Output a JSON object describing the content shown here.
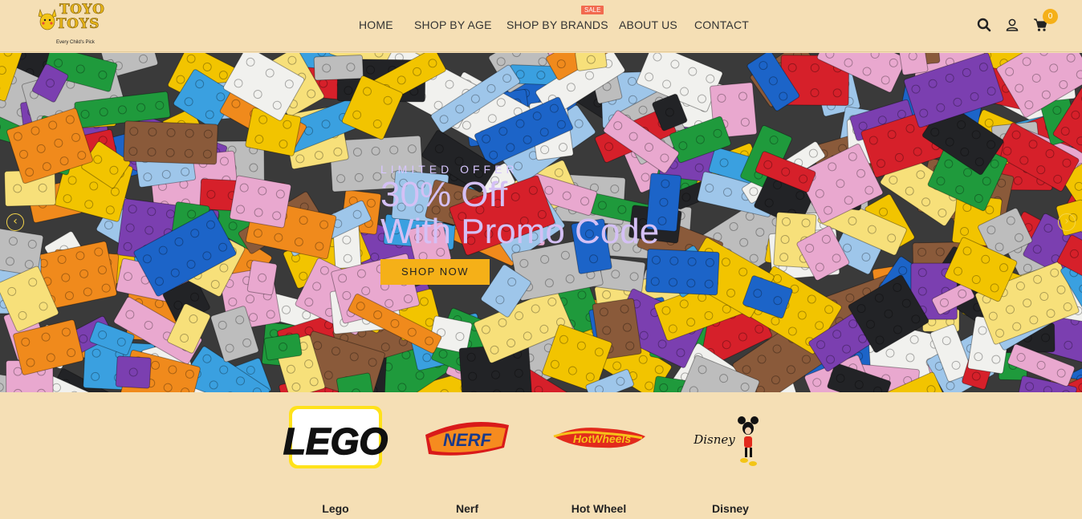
{
  "header": {
    "logo": {
      "line1": "TOYO",
      "line2": "TOYS",
      "tagline": "Every Child's Pick"
    },
    "nav": [
      {
        "label": "HOME"
      },
      {
        "label": "SHOP BY AGE"
      },
      {
        "label": "SHOP BY BRANDS",
        "badge": "SALE"
      },
      {
        "label": "ABOUT US"
      },
      {
        "label": "CONTACT"
      }
    ],
    "icons": [
      "search-icon",
      "user-icon",
      "cart-icon"
    ],
    "cart_count": "0"
  },
  "hero": {
    "kicker": "LIMITED OFFER",
    "title_line1": "30% Off",
    "title_line2": "With Promo Code",
    "cta": "SHOP NOW",
    "prev_icon": "chevron-left-icon",
    "next_icon": "chevron-right-icon"
  },
  "brands": [
    {
      "name": "Lego",
      "logo_text": "LEGO"
    },
    {
      "name": "Nerf",
      "logo_text": "NERF"
    },
    {
      "name": "Hot Wheel",
      "logo_text": "HotWheels"
    },
    {
      "name": "Disney",
      "logo_text": "Disney"
    }
  ],
  "colors": {
    "page_bg": "#f5dfb5",
    "accent": "#f5b018",
    "sale_badge": "#f26a4f",
    "hero_text": "#d4c0f5"
  }
}
